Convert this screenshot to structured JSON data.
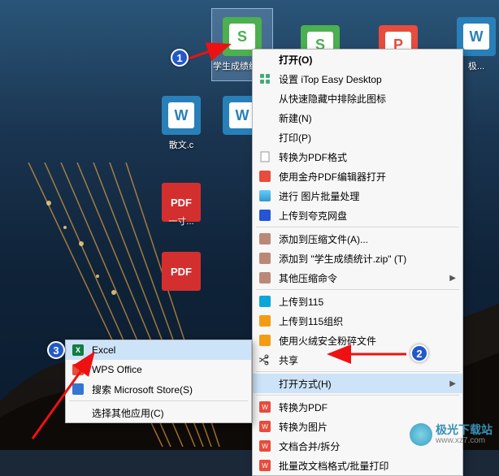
{
  "desktop_icons": {
    "selected": {
      "glyph": "S",
      "label": "学生成绩统计.x..."
    },
    "s2": {
      "glyph": "S",
      "label": ""
    },
    "p": {
      "glyph": "P",
      "label": ""
    },
    "w": {
      "glyph": "W",
      "label": "极..."
    },
    "w2": {
      "glyph": "W",
      "label": ""
    },
    "sanwen": {
      "glyph": "W",
      "label": "散文.c"
    },
    "pdf1": {
      "glyph": "PDF",
      "label": ""
    },
    "pdf2": {
      "glyph": "PDF",
      "label": "一寸..."
    }
  },
  "ctx": {
    "open": "打开(O)",
    "itop": "设置 iTop Easy Desktop",
    "hide": "从快速隐藏中排除此图标",
    "new": "新建(N)",
    "print": "打印(P)",
    "pdf": "转换为PDF格式",
    "jinzhou": "使用金舟PDF编辑器打开",
    "imgbatch": "进行 图片批量处理",
    "kuake": "上传到夸克网盘",
    "compressA": "添加到压缩文件(A)...",
    "compressZip": "添加到 \"学生成绩统计.zip\" (T)",
    "compressOther": "其他压缩命令",
    "upload115": "上传到115",
    "upload115org": "上传到115组织",
    "huorong": "使用火绒安全粉碎文件",
    "share": "共享",
    "openwith": "打开方式(H)",
    "wps_pdf": "转换为PDF",
    "wps_img": "转换为图片",
    "wps_merge": "文档合并/拆分",
    "wps_batch": "批量改文档格式/批量打印"
  },
  "sub": {
    "excel": "Excel",
    "wps": "WPS Office",
    "store": "搜索 Microsoft Store(S)",
    "other": "选择其他应用(C)"
  },
  "badges": {
    "b1": "1",
    "b2": "2",
    "b3": "3"
  },
  "watermark": {
    "name": "极光下载站",
    "url": "www.xz7.com"
  }
}
